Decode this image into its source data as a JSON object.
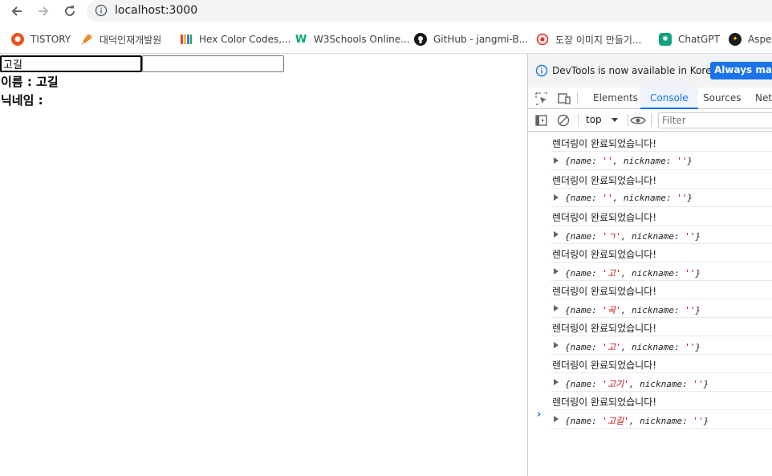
{
  "browser": {
    "url": "localhost:3000",
    "bookmarks": [
      {
        "label": "TISTORY",
        "icon": "tistory-icon",
        "color": "#eb531f"
      },
      {
        "label": "대덕인재개발원",
        "icon": "leaf-icon",
        "color": "#f0a030"
      },
      {
        "label": "Hex Color Codes,...",
        "icon": "color-bars-icon",
        "color": "#2b6ccf"
      },
      {
        "label": "W3Schools Online...",
        "icon": "w3schools-icon",
        "color": "#04aa6d"
      },
      {
        "label": "GitHub - jangmi-B...",
        "icon": "github-icon",
        "color": "#181717"
      },
      {
        "label": "도장 이미지 만들기...",
        "icon": "stamp-icon",
        "color": "#d93025"
      },
      {
        "label": "ChatGPT",
        "icon": "chatgpt-icon",
        "color": "#10a37f"
      },
      {
        "label": "Aspec",
        "icon": "aspect-icon",
        "color": "#e8c300"
      }
    ]
  },
  "page": {
    "name_input_value": "고길",
    "nick_input_value": "",
    "name_line": "이름 : 고길",
    "nick_line": "닉네임 :"
  },
  "devtools": {
    "infobar_message": "DevTools is now available in Korean!",
    "infobar_button": "Always match",
    "tabs": [
      {
        "label": "Elements",
        "active": false
      },
      {
        "label": "Console",
        "active": true
      },
      {
        "label": "Sources",
        "active": false
      },
      {
        "label": "Netw",
        "active": false
      }
    ],
    "context": "top",
    "filter_placeholder": "Filter",
    "logs": [
      {
        "text": "렌더링이 완료되었습니다!",
        "name": "''",
        "nickname": "''"
      },
      {
        "text": "렌더링이 완료되었습니다!",
        "name": "''",
        "nickname": "''"
      },
      {
        "text": "렌더링이 완료되었습니다!",
        "name": "'ㄱ'",
        "nickname": "''"
      },
      {
        "text": "렌더링이 완료되었습니다!",
        "name": "'고'",
        "nickname": "''"
      },
      {
        "text": "렌더링이 완료되었습니다!",
        "name": "'곡'",
        "nickname": "''"
      },
      {
        "text": "렌더링이 완료되었습니다!",
        "name": "'고'",
        "nickname": "''"
      },
      {
        "text": "렌더링이 완료되었습니다!",
        "name": "'고기'",
        "nickname": "''"
      },
      {
        "text": "렌더링이 완료되었습니다!",
        "name": "'고길'",
        "nickname": "''"
      }
    ],
    "prompt": "›"
  }
}
